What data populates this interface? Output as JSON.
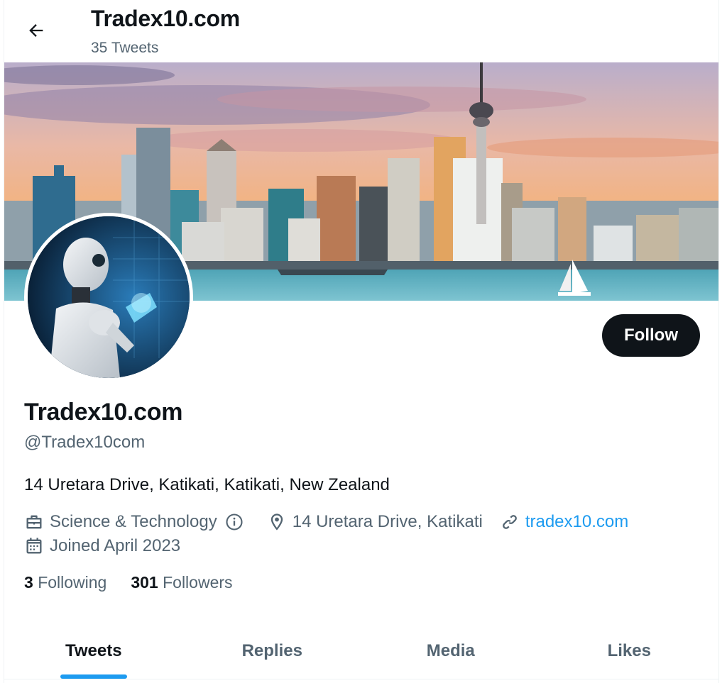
{
  "header": {
    "title": "Tradex10.com",
    "tweet_count": "35 Tweets"
  },
  "profile": {
    "display_name": "Tradex10.com",
    "handle": "@Tradex10com",
    "bio": "14 Uretara Drive, Katikati, Katikati, New Zealand",
    "category": "Science & Technology",
    "location": "14 Uretara Drive, Katikati",
    "website": "tradex10.com",
    "joined": "Joined April 2023",
    "following_count": "3",
    "following_label": "Following",
    "followers_count": "301",
    "followers_label": "Followers"
  },
  "actions": {
    "follow_label": "Follow"
  },
  "tabs": [
    {
      "label": "Tweets",
      "active": true
    },
    {
      "label": "Replies",
      "active": false
    },
    {
      "label": "Media",
      "active": false
    },
    {
      "label": "Likes",
      "active": false
    }
  ],
  "colors": {
    "accent": "#1d9bf0",
    "text_primary": "#0f1419",
    "text_secondary": "#536471",
    "button_dark": "#0f1419"
  },
  "icons": {
    "back": "arrow-left-icon",
    "category": "briefcase-icon",
    "info": "info-icon",
    "location": "map-pin-icon",
    "link": "link-icon",
    "calendar": "calendar-icon"
  }
}
